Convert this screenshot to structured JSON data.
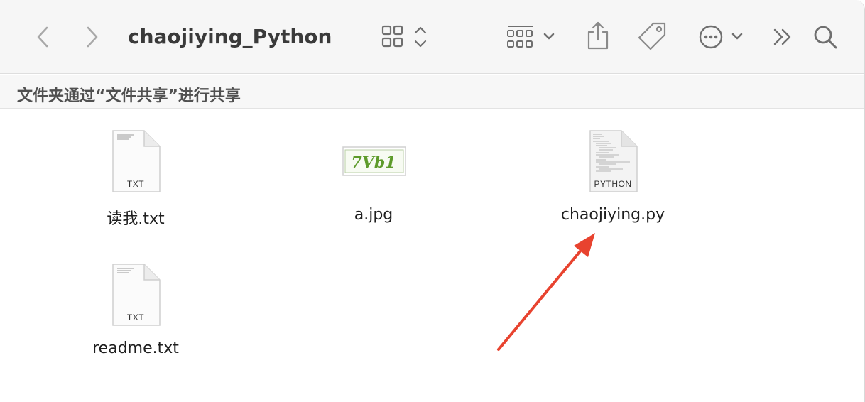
{
  "window": {
    "title": "chaojiying_Python",
    "info_bar": "文件夹通过“文件共享”进行共享"
  },
  "toolbar": {
    "back_icon": "chevron-left-icon",
    "forward_icon": "chevron-right-icon",
    "view_icon": "grid-view-icon",
    "group_icon": "grid-group-icon",
    "share_icon": "share-icon",
    "tag_icon": "tag-icon",
    "more_icon": "ellipsis-circle-icon",
    "overflow_icon": "double-chevron-right-icon",
    "search_icon": "search-icon"
  },
  "files": [
    {
      "name": "读我.txt",
      "badge": "TXT",
      "kind": "text"
    },
    {
      "name": "a.jpg",
      "badge": "",
      "kind": "image",
      "thumb_text": "7Vb1"
    },
    {
      "name": "chaojiying.py",
      "badge": "PYTHON",
      "kind": "python"
    },
    {
      "name": "readme.txt",
      "badge": "TXT",
      "kind": "text"
    }
  ],
  "annotation": {
    "arrow_color": "#e8432f"
  },
  "colors": {
    "toolbar_bg": "#f6f6f6",
    "icon_gray": "#8a8a8a",
    "arrow": "#e8432f"
  }
}
